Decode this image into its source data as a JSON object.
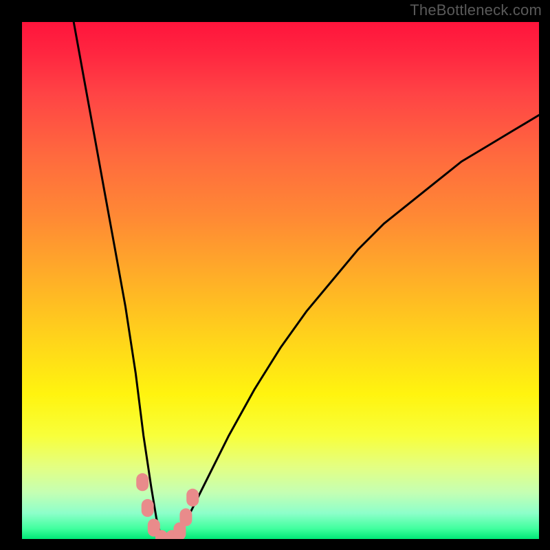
{
  "watermark": "TheBottleneck.com",
  "chart_data": {
    "type": "line",
    "title": "",
    "xlabel": "",
    "ylabel": "",
    "xlim": [
      0,
      100
    ],
    "ylim": [
      0,
      100
    ],
    "grid": false,
    "legend": false,
    "series": [
      {
        "name": "bottleneck-curve",
        "color": "#000000",
        "x": [
          10,
          12,
          14,
          16,
          18,
          20,
          22,
          23.5,
          25,
          26,
          27,
          28,
          30,
          32,
          35,
          40,
          45,
          50,
          55,
          60,
          65,
          70,
          75,
          80,
          85,
          90,
          95,
          100
        ],
        "y": [
          100,
          89,
          78,
          67,
          56,
          45,
          32,
          20,
          10,
          4,
          0,
          0,
          0,
          4,
          10,
          20,
          29,
          37,
          44,
          50,
          56,
          61,
          65,
          69,
          73,
          76,
          79,
          82
        ]
      }
    ],
    "markers": [
      {
        "name": "marker",
        "x": 23.3,
        "y": 11.0
      },
      {
        "name": "marker",
        "x": 24.3,
        "y": 6.0
      },
      {
        "name": "marker",
        "x": 25.5,
        "y": 2.2
      },
      {
        "name": "marker",
        "x": 27.0,
        "y": 0.0
      },
      {
        "name": "marker",
        "x": 29.0,
        "y": 0.0
      },
      {
        "name": "marker",
        "x": 30.5,
        "y": 1.5
      },
      {
        "name": "marker",
        "x": 31.7,
        "y": 4.2
      },
      {
        "name": "marker",
        "x": 33.0,
        "y": 8.0
      }
    ],
    "gradient_stops": [
      {
        "pos": 0,
        "color": "#ff143c"
      },
      {
        "pos": 50,
        "color": "#ffd61a"
      },
      {
        "pos": 80,
        "color": "#f8ff3a"
      },
      {
        "pos": 100,
        "color": "#00e876"
      }
    ]
  }
}
